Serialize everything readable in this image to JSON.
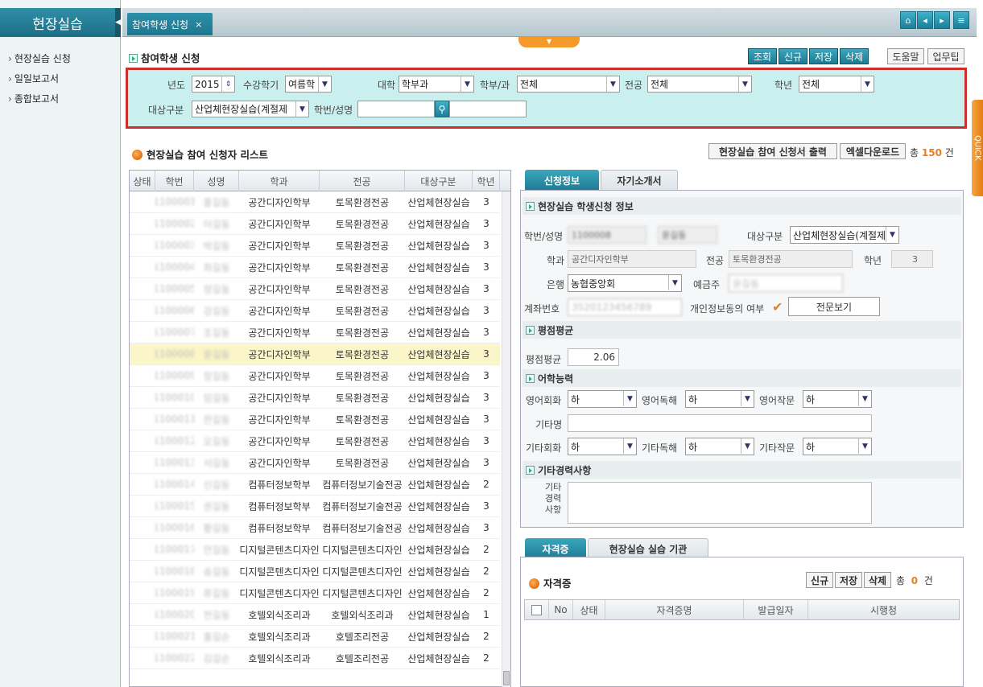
{
  "sidebar": {
    "title": "현장실습",
    "items": [
      {
        "label": "현장실습 신청"
      },
      {
        "label": "일일보고서"
      },
      {
        "label": "종합보고서"
      }
    ]
  },
  "topbar": {
    "tab_label": "참여학생 신청",
    "tab_close": "×",
    "quick": "QUICK"
  },
  "page": {
    "title": "참여학생 신청",
    "buttons": {
      "search": "조회",
      "new": "신규",
      "save": "저장",
      "delete": "삭제",
      "help": "도움말",
      "tips": "업무팁"
    }
  },
  "search": {
    "year_label": "년도",
    "year_value": "2015",
    "semester_label": "수강학기",
    "semester_value": "여름학",
    "college_label": "대학",
    "college_value": "학부과",
    "dept_label": "학부/과",
    "dept_value": "전체",
    "major_label": "전공",
    "major_value": "전체",
    "grade_label": "학년",
    "grade_value": "전체",
    "target_label": "대상구분",
    "target_value": "산업체현장실습(계절제",
    "student_label": "학번/성명"
  },
  "list": {
    "title": "현장실습 참여 신청자 리스트",
    "print_button": "현장실습 참여 신청서 출력",
    "excel_button": "엑셀다운로드",
    "total_prefix": "총",
    "total_count": "150",
    "total_suffix": "건",
    "columns": [
      "상태",
      "학번",
      "성명",
      "학과",
      "전공",
      "대상구분",
      "학년"
    ],
    "rows": [
      {
        "id": "1100001",
        "name": "홍길동",
        "dept": "공간디자인학부",
        "major": "토목환경전공",
        "target": "산업체현장실습",
        "grade": "3"
      },
      {
        "id": "1100002",
        "name": "이길동",
        "dept": "공간디자인학부",
        "major": "토목환경전공",
        "target": "산업체현장실습",
        "grade": "3"
      },
      {
        "id": "1100003",
        "name": "박길동",
        "dept": "공간디자인학부",
        "major": "토목환경전공",
        "target": "산업체현장실습",
        "grade": "3"
      },
      {
        "id": "1100004",
        "name": "최길동",
        "dept": "공간디자인학부",
        "major": "토목환경전공",
        "target": "산업체현장실습",
        "grade": "3"
      },
      {
        "id": "1100005",
        "name": "정길동",
        "dept": "공간디자인학부",
        "major": "토목환경전공",
        "target": "산업체현장실습",
        "grade": "3"
      },
      {
        "id": "1100006",
        "name": "강길동",
        "dept": "공간디자인학부",
        "major": "토목환경전공",
        "target": "산업체현장실습",
        "grade": "3"
      },
      {
        "id": "1100007",
        "name": "조길동",
        "dept": "공간디자인학부",
        "major": "토목환경전공",
        "target": "산업체현장실습",
        "grade": "3"
      },
      {
        "id": "1100008",
        "name": "윤길동",
        "dept": "공간디자인학부",
        "major": "토목환경전공",
        "target": "산업체현장실습",
        "grade": "3"
      },
      {
        "id": "1100009",
        "name": "장길동",
        "dept": "공간디자인학부",
        "major": "토목환경전공",
        "target": "산업체현장실습",
        "grade": "3"
      },
      {
        "id": "1100010",
        "name": "임길동",
        "dept": "공간디자인학부",
        "major": "토목환경전공",
        "target": "산업체현장실습",
        "grade": "3"
      },
      {
        "id": "1100011",
        "name": "한길동",
        "dept": "공간디자인학부",
        "major": "토목환경전공",
        "target": "산업체현장실습",
        "grade": "3"
      },
      {
        "id": "1100012",
        "name": "오길동",
        "dept": "공간디자인학부",
        "major": "토목환경전공",
        "target": "산업체현장실습",
        "grade": "3"
      },
      {
        "id": "1100013",
        "name": "서길동",
        "dept": "공간디자인학부",
        "major": "토목환경전공",
        "target": "산업체현장실습",
        "grade": "3"
      },
      {
        "id": "1100014",
        "name": "신길동",
        "dept": "컴퓨터정보학부",
        "major": "컴퓨터정보기술전공",
        "target": "산업체현장실습",
        "grade": "2"
      },
      {
        "id": "1100015",
        "name": "권길동",
        "dept": "컴퓨터정보학부",
        "major": "컴퓨터정보기술전공",
        "target": "산업체현장실습",
        "grade": "3"
      },
      {
        "id": "1100016",
        "name": "황길동",
        "dept": "컴퓨터정보학부",
        "major": "컴퓨터정보기술전공",
        "target": "산업체현장실습",
        "grade": "3"
      },
      {
        "id": "1100017",
        "name": "안길동",
        "dept": "디지털콘텐츠디자인",
        "major": "디지털콘텐츠디자인",
        "target": "산업체현장실습",
        "grade": "2"
      },
      {
        "id": "1100018",
        "name": "송길동",
        "dept": "디지털콘텐츠디자인",
        "major": "디지털콘텐츠디자인",
        "target": "산업체현장실습",
        "grade": "2"
      },
      {
        "id": "1100019",
        "name": "류길동",
        "dept": "디지털콘텐츠디자인",
        "major": "디지털콘텐츠디자인",
        "target": "산업체현장실습",
        "grade": "2"
      },
      {
        "id": "1100020",
        "name": "전길동",
        "dept": "호텔외식조리과",
        "major": "호텔외식조리과",
        "target": "산업체현장실습",
        "grade": "1"
      },
      {
        "id": "1100021",
        "name": "홍길순",
        "dept": "호텔외식조리과",
        "major": "호텔조리전공",
        "target": "산업체현장실습",
        "grade": "2"
      },
      {
        "id": "1100022",
        "name": "김길순",
        "dept": "호텔외식조리과",
        "major": "호텔조리전공",
        "target": "산업체현장실습",
        "grade": "2"
      }
    ]
  },
  "detail": {
    "tab_apply": "신청정보",
    "tab_intro": "자기소개서",
    "sec_info": "현장실습 학생신청 정보",
    "student_label": "학번/성명",
    "student_id": "1100008",
    "student_name": "윤길동",
    "target_label": "대상구분",
    "target_value": "산업체현장실습(계절제",
    "dept_label": "학과",
    "dept_value": "공간디자인학부",
    "major_label": "전공",
    "major_value": "토목환경전공",
    "grade_label": "학년",
    "grade_value": "3",
    "bank_label": "은행",
    "bank_value": "농협중앙회",
    "holder_label": "예금주",
    "holder_value": "윤길동",
    "account_label": "계좌번호",
    "account_value": "3520123456789",
    "consent_label": "개인정보동의 여부",
    "fulltext_button": "전문보기",
    "sec_gpa": "평점평균",
    "gpa_label": "평점평균",
    "gpa_value": "2.06",
    "sec_lang": "어학능력",
    "eng_conv_label": "영어회화",
    "eng_conv_value": "하",
    "eng_read_label": "영어독해",
    "eng_read_value": "하",
    "eng_write_label": "영어작문",
    "eng_write_value": "하",
    "other_name_label": "기타명",
    "other_conv_label": "기타회화",
    "other_conv_value": "하",
    "other_read_label": "기타독해",
    "other_read_value": "하",
    "other_write_label": "기타작문",
    "other_write_value": "하",
    "sec_career": "기타경력사항",
    "career_label_1": "기타",
    "career_label_2": "경력",
    "career_label_3": "사항"
  },
  "cert": {
    "tab_cert": "자격증",
    "tab_org": "현장실습 실습 기관",
    "title": "자격증",
    "new": "신규",
    "save": "저장",
    "delete": "삭제",
    "total_prefix": "총",
    "total_count": "0",
    "total_suffix": "건",
    "columns": [
      "No",
      "상태",
      "자격증명",
      "발급일자",
      "시행청"
    ]
  },
  "colors": {
    "accent": "#1e7a92",
    "highlight": "#c9302c",
    "orange": "#f39a2b"
  }
}
